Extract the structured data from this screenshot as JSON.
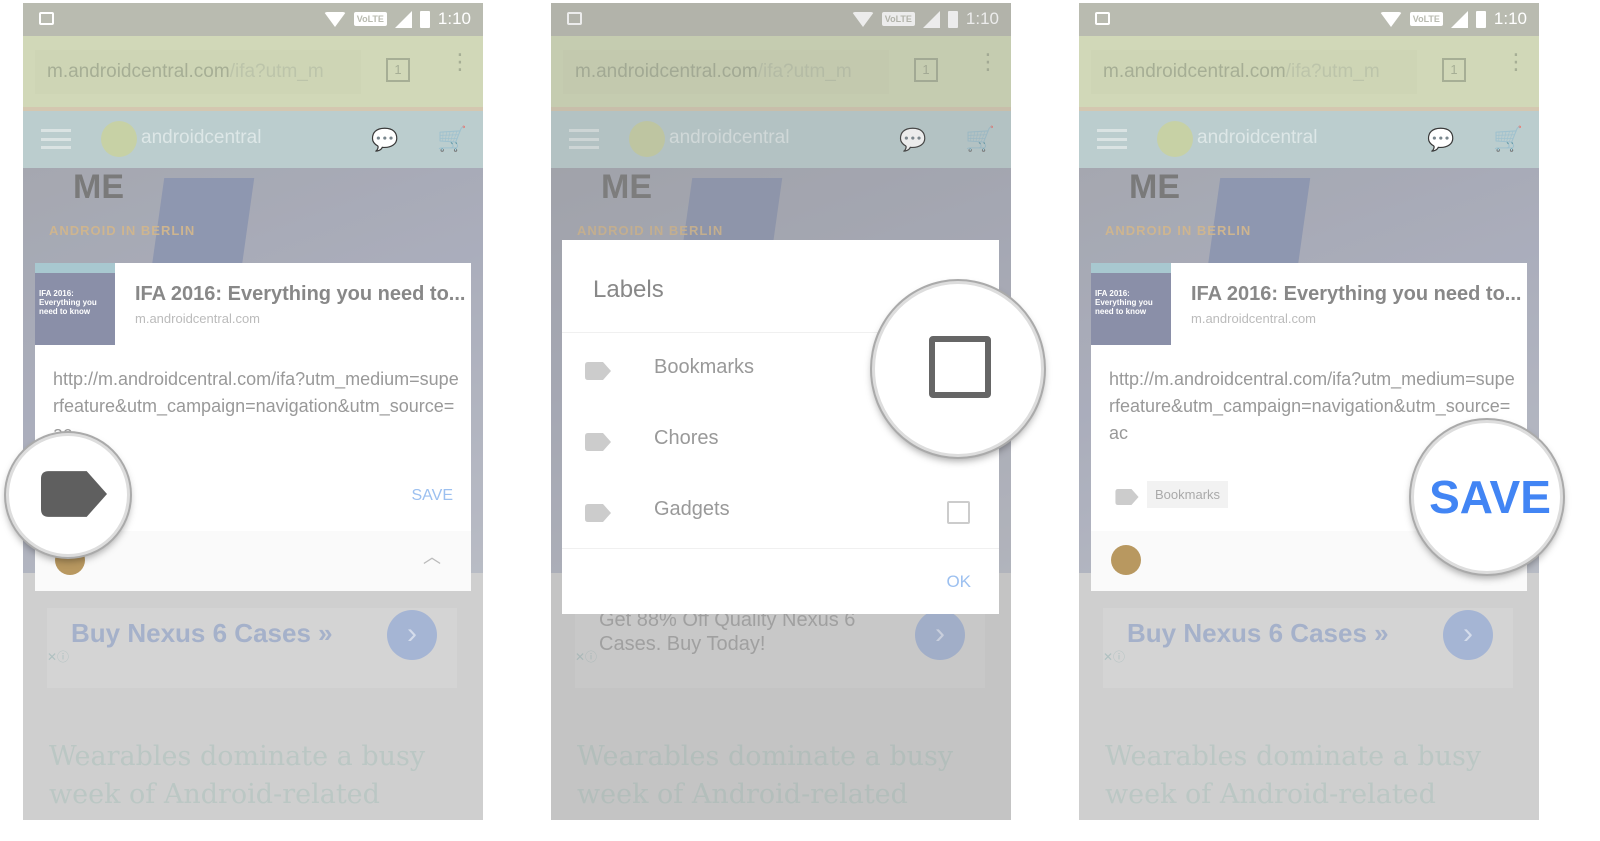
{
  "status_bar": {
    "time": "1:10",
    "network": "VoLTE",
    "icons": [
      "image-icon",
      "wifi-icon",
      "volte-icon",
      "signal-icon",
      "battery-icon"
    ]
  },
  "browser": {
    "url_host": "m.androidcentral.com",
    "url_path": "/ifa?utm_m",
    "tab_count": "1"
  },
  "site": {
    "logo_text": "androidcentral",
    "hero_sign": "ME",
    "category": "ANDROID IN BERLIN"
  },
  "background": {
    "ad_text": "Buy Nexus 6 Cases »",
    "ad_text_alt": "Get 88% Off Quality Nexus 6 Cases. Buy Today!",
    "headline": "Wearables dominate a busy week of Android-related"
  },
  "card": {
    "title": "IFA 2016: Everything you need to...",
    "host": "m.androidcentral.com",
    "thumb_text": "IFA 2016: Everything you need to know",
    "url": "http://m.androidcentral.com/ifa?utm_medium=superfeature&utm_campaign=navigation&utm_source=ac",
    "save_label": "SAVE",
    "chip_label": "Bookmarks"
  },
  "labels_dialog": {
    "title": "Labels",
    "items": [
      {
        "label": "Bookmarks",
        "checked": false
      },
      {
        "label": "Chores",
        "checked": false
      },
      {
        "label": "Gadgets",
        "checked": false
      }
    ],
    "ok_label": "OK"
  },
  "colors": {
    "accent": "#4285f4",
    "accent_faded": "#9cc0f0",
    "label_icon": "#5f5f5f"
  }
}
